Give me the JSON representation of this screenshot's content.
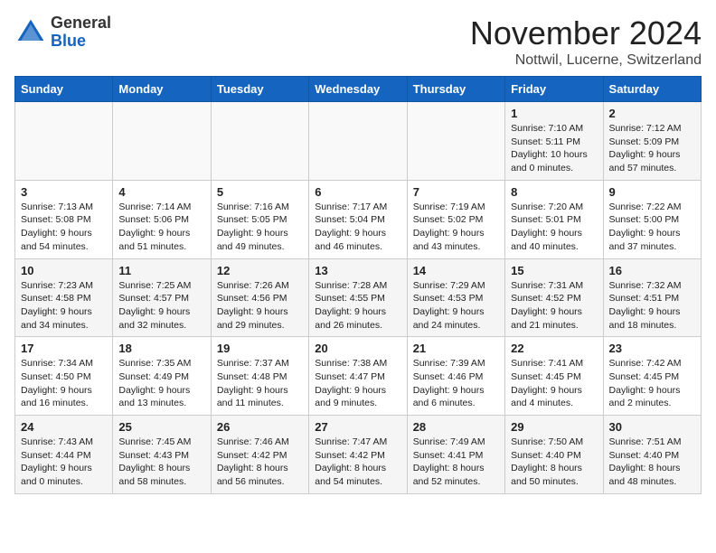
{
  "header": {
    "logo_general": "General",
    "logo_blue": "Blue",
    "month": "November 2024",
    "location": "Nottwil, Lucerne, Switzerland"
  },
  "days_of_week": [
    "Sunday",
    "Monday",
    "Tuesday",
    "Wednesday",
    "Thursday",
    "Friday",
    "Saturday"
  ],
  "weeks": [
    [
      {
        "day": "",
        "info": ""
      },
      {
        "day": "",
        "info": ""
      },
      {
        "day": "",
        "info": ""
      },
      {
        "day": "",
        "info": ""
      },
      {
        "day": "",
        "info": ""
      },
      {
        "day": "1",
        "info": "Sunrise: 7:10 AM\nSunset: 5:11 PM\nDaylight: 10 hours and 0 minutes."
      },
      {
        "day": "2",
        "info": "Sunrise: 7:12 AM\nSunset: 5:09 PM\nDaylight: 9 hours and 57 minutes."
      }
    ],
    [
      {
        "day": "3",
        "info": "Sunrise: 7:13 AM\nSunset: 5:08 PM\nDaylight: 9 hours and 54 minutes."
      },
      {
        "day": "4",
        "info": "Sunrise: 7:14 AM\nSunset: 5:06 PM\nDaylight: 9 hours and 51 minutes."
      },
      {
        "day": "5",
        "info": "Sunrise: 7:16 AM\nSunset: 5:05 PM\nDaylight: 9 hours and 49 minutes."
      },
      {
        "day": "6",
        "info": "Sunrise: 7:17 AM\nSunset: 5:04 PM\nDaylight: 9 hours and 46 minutes."
      },
      {
        "day": "7",
        "info": "Sunrise: 7:19 AM\nSunset: 5:02 PM\nDaylight: 9 hours and 43 minutes."
      },
      {
        "day": "8",
        "info": "Sunrise: 7:20 AM\nSunset: 5:01 PM\nDaylight: 9 hours and 40 minutes."
      },
      {
        "day": "9",
        "info": "Sunrise: 7:22 AM\nSunset: 5:00 PM\nDaylight: 9 hours and 37 minutes."
      }
    ],
    [
      {
        "day": "10",
        "info": "Sunrise: 7:23 AM\nSunset: 4:58 PM\nDaylight: 9 hours and 34 minutes."
      },
      {
        "day": "11",
        "info": "Sunrise: 7:25 AM\nSunset: 4:57 PM\nDaylight: 9 hours and 32 minutes."
      },
      {
        "day": "12",
        "info": "Sunrise: 7:26 AM\nSunset: 4:56 PM\nDaylight: 9 hours and 29 minutes."
      },
      {
        "day": "13",
        "info": "Sunrise: 7:28 AM\nSunset: 4:55 PM\nDaylight: 9 hours and 26 minutes."
      },
      {
        "day": "14",
        "info": "Sunrise: 7:29 AM\nSunset: 4:53 PM\nDaylight: 9 hours and 24 minutes."
      },
      {
        "day": "15",
        "info": "Sunrise: 7:31 AM\nSunset: 4:52 PM\nDaylight: 9 hours and 21 minutes."
      },
      {
        "day": "16",
        "info": "Sunrise: 7:32 AM\nSunset: 4:51 PM\nDaylight: 9 hours and 18 minutes."
      }
    ],
    [
      {
        "day": "17",
        "info": "Sunrise: 7:34 AM\nSunset: 4:50 PM\nDaylight: 9 hours and 16 minutes."
      },
      {
        "day": "18",
        "info": "Sunrise: 7:35 AM\nSunset: 4:49 PM\nDaylight: 9 hours and 13 minutes."
      },
      {
        "day": "19",
        "info": "Sunrise: 7:37 AM\nSunset: 4:48 PM\nDaylight: 9 hours and 11 minutes."
      },
      {
        "day": "20",
        "info": "Sunrise: 7:38 AM\nSunset: 4:47 PM\nDaylight: 9 hours and 9 minutes."
      },
      {
        "day": "21",
        "info": "Sunrise: 7:39 AM\nSunset: 4:46 PM\nDaylight: 9 hours and 6 minutes."
      },
      {
        "day": "22",
        "info": "Sunrise: 7:41 AM\nSunset: 4:45 PM\nDaylight: 9 hours and 4 minutes."
      },
      {
        "day": "23",
        "info": "Sunrise: 7:42 AM\nSunset: 4:45 PM\nDaylight: 9 hours and 2 minutes."
      }
    ],
    [
      {
        "day": "24",
        "info": "Sunrise: 7:43 AM\nSunset: 4:44 PM\nDaylight: 9 hours and 0 minutes."
      },
      {
        "day": "25",
        "info": "Sunrise: 7:45 AM\nSunset: 4:43 PM\nDaylight: 8 hours and 58 minutes."
      },
      {
        "day": "26",
        "info": "Sunrise: 7:46 AM\nSunset: 4:42 PM\nDaylight: 8 hours and 56 minutes."
      },
      {
        "day": "27",
        "info": "Sunrise: 7:47 AM\nSunset: 4:42 PM\nDaylight: 8 hours and 54 minutes."
      },
      {
        "day": "28",
        "info": "Sunrise: 7:49 AM\nSunset: 4:41 PM\nDaylight: 8 hours and 52 minutes."
      },
      {
        "day": "29",
        "info": "Sunrise: 7:50 AM\nSunset: 4:40 PM\nDaylight: 8 hours and 50 minutes."
      },
      {
        "day": "30",
        "info": "Sunrise: 7:51 AM\nSunset: 4:40 PM\nDaylight: 8 hours and 48 minutes."
      }
    ]
  ]
}
